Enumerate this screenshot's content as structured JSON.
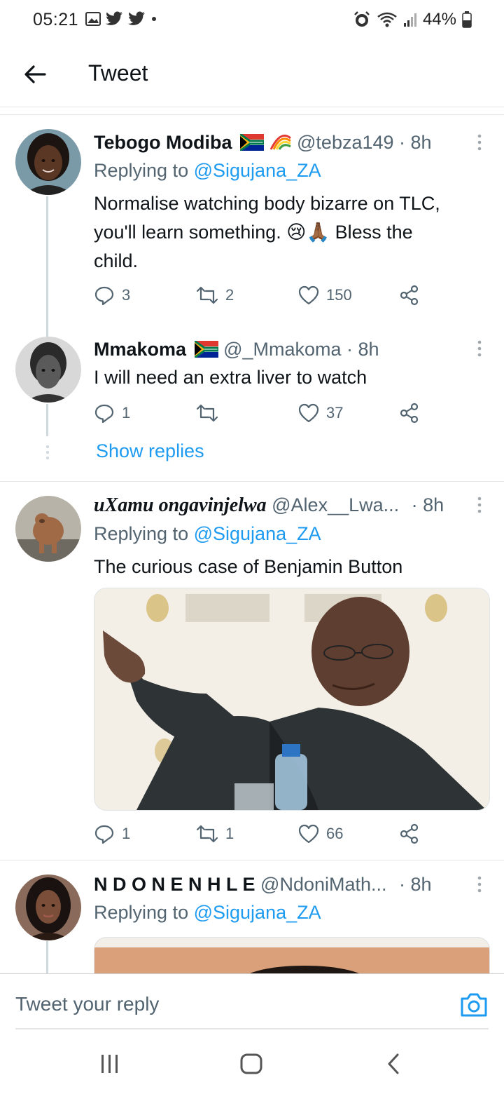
{
  "status_bar": {
    "time": "05:21",
    "battery": "44%"
  },
  "header": {
    "title": "Tweet"
  },
  "tweets": [
    {
      "name": "Tebogo Modiba",
      "handle": "@tebza149",
      "time": "· 8h",
      "reply_prefix": "Replying to",
      "reply_to": "@Sigujana_ZA",
      "lines": [
        "Normalise watching body bizarre on TLC,",
        "you'll learn something. 😢🙏🏾 Bless the",
        "child."
      ],
      "replies": "3",
      "retweets": "2",
      "likes": "150"
    },
    {
      "name": "Mmakoma",
      "handle": "@_Mmakoma",
      "time": "· 8h",
      "text": "I will need an extra liver to watch",
      "replies": "1",
      "retweets": "",
      "likes": "37"
    },
    {
      "name": "uXamu ongavinjelwa",
      "handle": "@Alex__Lwa...",
      "time": "· 8h",
      "reply_prefix": "Replying to",
      "reply_to": "@Sigujana_ZA",
      "text": "The curious case of Benjamin Button",
      "replies": "1",
      "retweets": "1",
      "likes": "66"
    },
    {
      "name": "N D O N E N H L E",
      "handle": "@NdoniMath...",
      "time": "· 8h",
      "reply_prefix": "Replying to",
      "reply_to": "@Sigujana_ZA"
    }
  ],
  "show_replies": "Show replies",
  "reply_bar": {
    "placeholder": "Tweet your reply"
  },
  "colors": {
    "accent": "#1d9bf0",
    "secondary_text": "#536471",
    "divider": "#e6e6e6"
  }
}
